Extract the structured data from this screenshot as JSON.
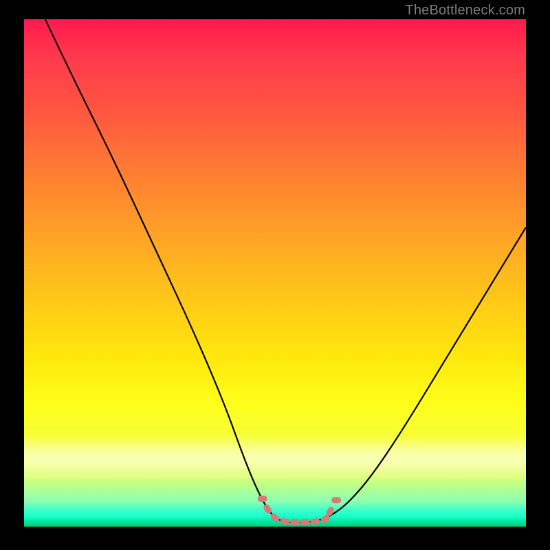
{
  "watermark": "TheBottleneck.com",
  "chart_data": {
    "type": "line",
    "title": "",
    "xlabel": "",
    "ylabel": "",
    "xlim": [
      0,
      100
    ],
    "ylim": [
      0,
      100
    ],
    "grid": false,
    "legend": false,
    "background": "heatmap-gradient",
    "gradient_colors": [
      "#ff1a4d",
      "#ff7d33",
      "#ffe60d",
      "#d9ff73",
      "#00cc7a"
    ],
    "series": [
      {
        "name": "bottleneck-curve",
        "color": "#000000",
        "x_pct": [
          4.2,
          10,
          18,
          26,
          34,
          40,
          44,
          47,
          49.5,
          52,
          55,
          58,
          61,
          65,
          70,
          76,
          84,
          92,
          100
        ],
        "y_pct": [
          100,
          88,
          72,
          55,
          38,
          24,
          13,
          6,
          2,
          0.8,
          0.8,
          1,
          2,
          5,
          11,
          20,
          33,
          46,
          59
        ]
      },
      {
        "name": "valley-markers",
        "color": "#d87a78",
        "type": "scatter",
        "x_pct": [
          47.5,
          48.5,
          50,
          52,
          54,
          56,
          58,
          60,
          61,
          62.2
        ],
        "y_pct": [
          5.5,
          3.5,
          1.8,
          1,
          0.9,
          0.9,
          1,
          1.5,
          3,
          5.2
        ]
      }
    ]
  }
}
